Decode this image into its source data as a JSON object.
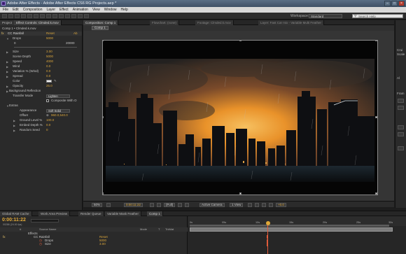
{
  "app": {
    "title": "Adobe After Effects - Adobe After Effects CS6 RG Projects.aep *",
    "window_controls": [
      "–",
      "□",
      "×"
    ]
  },
  "menu": [
    "File",
    "Edit",
    "Composition",
    "Layer",
    "Effect",
    "Animation",
    "View",
    "Window",
    "Help"
  ],
  "workspace": {
    "label": "Workspace:",
    "value": "Standard"
  },
  "search": {
    "placeholder": "Search Help"
  },
  "left_panel": {
    "tabs": [
      "Project",
      "Effect Controls: Clmded.k.mov"
    ],
    "breadcrumb": "Comp 1 • Clmded.k.mov",
    "effect_name": "CC Rainfall",
    "reset": "Reset",
    "about": "Ab",
    "params": [
      {
        "label": "Drops",
        "value": "5000"
      },
      {
        "label": "0",
        "value": "20000"
      },
      {
        "label": "Size",
        "value": "3.00"
      },
      {
        "label": "Scene Depth",
        "value": "5000"
      },
      {
        "label": "Speed",
        "value": "4000"
      },
      {
        "label": "Wind",
        "value": "0.0"
      },
      {
        "label": "Variation % (Wind)",
        "value": "0.0"
      },
      {
        "label": "Spread",
        "value": "0.0"
      },
      {
        "label": "Color",
        "value": ""
      },
      {
        "label": "Opacity",
        "value": "25.0"
      },
      {
        "label": "Background Reflection",
        "value": ""
      },
      {
        "label": "Transfer Mode",
        "value": "Lighten"
      },
      {
        "label": "",
        "value": "Composite With O"
      },
      {
        "label": "Extras",
        "value": ""
      },
      {
        "label": "Appearance",
        "value": "Soft Solid"
      },
      {
        "label": "Offset",
        "value": "960.0,540.0"
      },
      {
        "label": "Ground Level %",
        "value": "100.0"
      },
      {
        "label": "Embed Depth %",
        "value": "0.0"
      },
      {
        "label": "Random Seed",
        "value": "0"
      }
    ]
  },
  "viewer": {
    "tabs": [
      "Composition: Comp 1",
      "Flowchart: (none)",
      "Footage: Clmded.k.mov",
      "Layer: Fast Car mix - Variable Multi Feather"
    ],
    "sub_tab": "Comp 1",
    "bar": {
      "zoom": "50%",
      "timecode": "0:00:11:22",
      "resolution": "(Full)",
      "camera": "Active Camera",
      "views": "1 View",
      "exposure": "+0.0"
    }
  },
  "right_panel": {
    "labels": [
      "Crui",
      "Scale",
      "Al",
      "Fram"
    ]
  },
  "timeline": {
    "tabs": [
      "Global RAM Cache",
      "Work Area Preview",
      "Render Queue",
      "Variable Mask Feather",
      "Comp 1"
    ],
    "timecode": "0:00:11:22",
    "frames": "00286 (24.00 fps)",
    "headers": [
      "#",
      "Source Name",
      "Mode",
      "T",
      "TrkMat"
    ],
    "rows": [
      {
        "name": "Effects",
        "value": ""
      },
      {
        "name": "CC Rainfall",
        "value": "Reset"
      },
      {
        "name": "Drops",
        "value": "5000"
      },
      {
        "name": "Size",
        "value": "3.00"
      }
    ],
    "ruler": [
      "0s",
      "05s",
      "10s",
      "15s",
      "20s",
      "25s",
      "30s"
    ]
  },
  "colors": {
    "accent_time": "#d9a53b",
    "cti": "#e15b3b",
    "sky_top": "#2d2a28",
    "sky_glow": "#e9922a"
  }
}
